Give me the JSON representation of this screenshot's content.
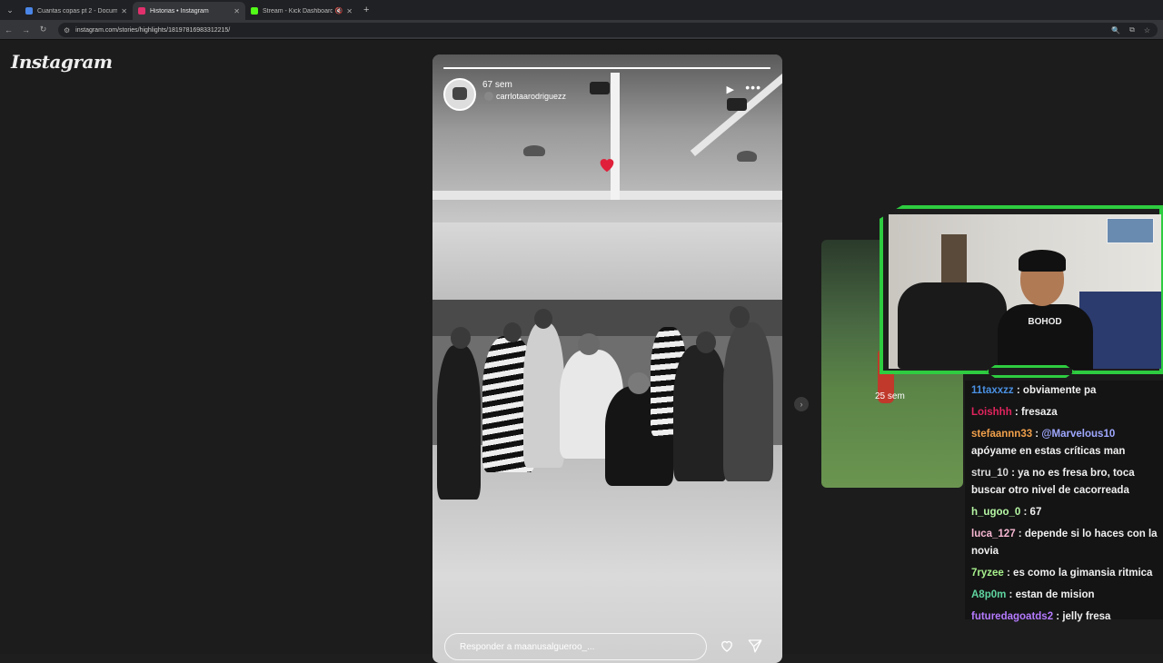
{
  "browser": {
    "tabs": [
      {
        "title": "Cuantas copas pt 2 - Documen",
        "active": false,
        "favicon_color": "#4a86e8"
      },
      {
        "title": "Historias • Instagram",
        "active": true,
        "favicon_color": "#e1306c"
      },
      {
        "title": "Stream - Kick Dashboard",
        "active": false,
        "favicon_color": "#53fc18",
        "muted": true
      }
    ],
    "url": "instagram.com/stories/highlights/18197816983312215/"
  },
  "instagram": {
    "logo": "Instagram",
    "story": {
      "time": "67 sem",
      "username": "carrlotaarodriguezz",
      "reply_placeholder": "Responder a maanusalgueroo_..."
    },
    "side_story": {
      "time": "25 sem"
    }
  },
  "webcam": {
    "shirt_text": "BOHOD"
  },
  "chat": {
    "messages": [
      {
        "user": "11taxxzz",
        "color": "#4a90e2",
        "text": "obviamente pa"
      },
      {
        "user": "Loishhh",
        "color": "#e0245e",
        "text": "fresaza"
      },
      {
        "user": "stefaannn33",
        "color": "#f0a04b",
        "mention": "@Marvelous10",
        "text": "apóyame en estas críticas man"
      },
      {
        "user": "stru_10",
        "color": "#d8d8d8",
        "text": "ya no es fresa bro, toca buscar otro nivel de cacorreada"
      },
      {
        "user": "h_ugoo_0",
        "color": "#b6f7a4",
        "text": "67"
      },
      {
        "user": "luca_127",
        "color": "#f7b7d2",
        "text": "depende si lo haces con la novia"
      },
      {
        "user": "7ryzee",
        "color": "#a6f08c",
        "text": "es como la gimansia ritmica"
      },
      {
        "user": "A8p0m",
        "color": "#5fd4a0",
        "text": "estan de mision"
      },
      {
        "user": "futuredagoatds2",
        "color": "#b57bff",
        "text": "jelly fresa"
      }
    ]
  }
}
